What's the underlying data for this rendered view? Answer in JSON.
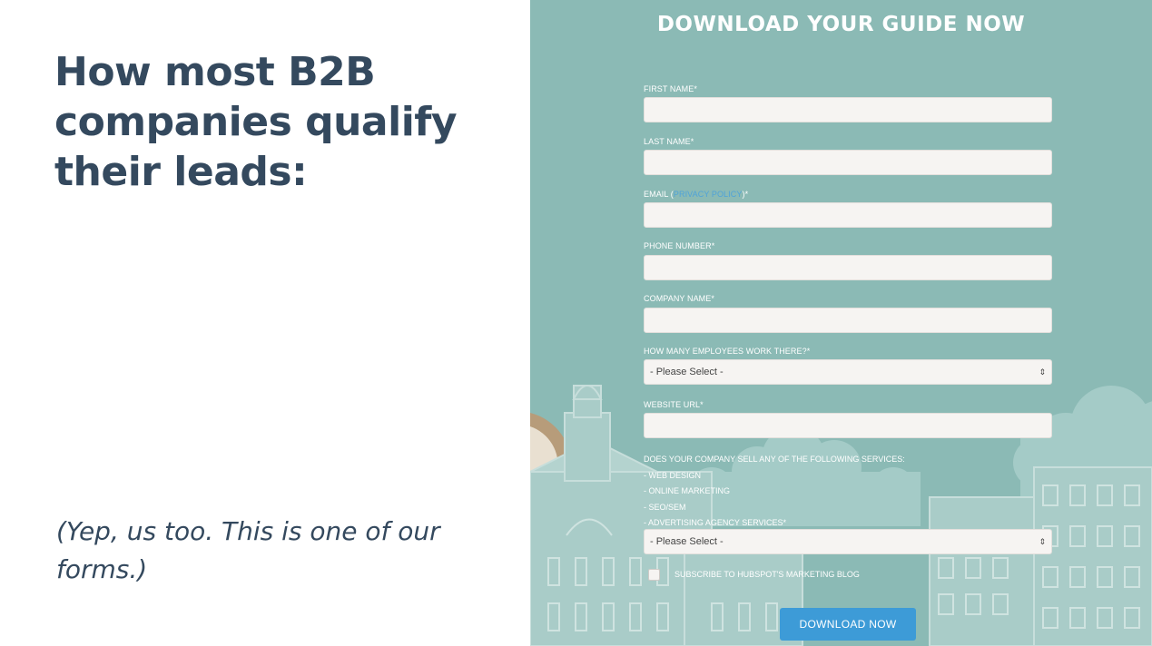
{
  "slide": {
    "heading": "How most B2B companies qualify their leads:",
    "caption": "(Yep, us too. This is one of our forms.)"
  },
  "form": {
    "title": "DOWNLOAD YOUR GUIDE NOW",
    "first_name_label": "FIRST NAME*",
    "last_name_label": "LAST NAME*",
    "email_label_prefix": "EMAIL (",
    "email_link": "PRIVACY POLICY",
    "email_label_suffix": ")*",
    "phone_label": "PHONE NUMBER*",
    "company_label": "COMPANY NAME*",
    "employees_label": "HOW MANY EMPLOYEES WORK THERE?*",
    "employees_selected": "- Please Select -",
    "website_label": "WEBSITE URL*",
    "services_question": "DOES YOUR COMPANY SELL ANY OF THE FOLLOWING SERVICES:",
    "services": [
      "- WEB DESIGN",
      "- ONLINE MARKETING",
      "- SEO/SEM",
      "- ADVERTISING AGENCY SERVICES*"
    ],
    "services_selected": "- Please Select -",
    "subscribe_label": "SUBSCRIBE TO HUBSPOT'S MARKETING BLOG",
    "submit_label": "DOWNLOAD NOW"
  },
  "colors": {
    "heading_text": "#34495e",
    "panel_bg": "#8bbab5",
    "button_bg": "#3d9bd7",
    "link": "#4fa3d9"
  },
  "icons": {
    "select_arrow": "updown-arrow-icon"
  }
}
